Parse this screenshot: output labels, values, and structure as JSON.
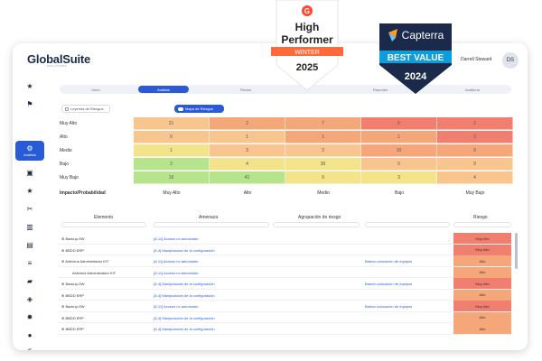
{
  "brand": {
    "name": "GlobalSuite",
    "sub": "SOLUTIONS",
    "user": "Darrell Steward",
    "avatar": "DS"
  },
  "sidebar": {
    "active_label": "Análisis"
  },
  "tabs": [
    "Inicio",
    "Análisis",
    "Planes",
    "",
    "Reportes",
    "Auditoría"
  ],
  "controls": {
    "legend_label": "Leyenda de Riesgos",
    "heatmap_label": "Mapa de Riesgos"
  },
  "heatmap": {
    "axis_label": "Impacto/Probabilidad",
    "rows": [
      "Muy Alto",
      "Alto",
      "Medio",
      "Bajo",
      "Muy Bajo"
    ],
    "cols": [
      "Muy Alto",
      "Alto",
      "Medio",
      "Bajo",
      "Muy Bajo"
    ],
    "values": [
      [
        "21",
        "2",
        "7",
        "0",
        "2"
      ],
      [
        "0",
        "1",
        "1",
        "1",
        "3"
      ],
      [
        "1",
        "3",
        "3",
        "10",
        "9"
      ],
      [
        "2",
        "4",
        "30",
        "0",
        "9"
      ],
      [
        "16",
        "41",
        "9",
        "3",
        "4"
      ]
    ]
  },
  "table": {
    "headers": [
      "Elemento",
      "Amenaza",
      "Agrupación de riesgo",
      "",
      "Riesgo"
    ],
    "rows": [
      {
        "el": "Backup-SW",
        "am": "[A.11] Acceso no autorizado",
        "ag": "",
        "op": "",
        "r": "Muy Alto"
      },
      {
        "el": "BBDD ERP",
        "am": "[A.4] Manipulación de la configuración",
        "ag": "",
        "op": "",
        "r": "Muy Alto"
      },
      {
        "el": "Antivirus Administrador KIT",
        "am": "[A.11] Acceso no autorizado",
        "ag": "",
        "op": "Baena colocación de equipos",
        "r": "Alto"
      },
      {
        "el": "Antivirus Administrador KIT",
        "am": "[A.11] Acceso no autorizado",
        "ag": "",
        "op": "",
        "r": "Alto"
      },
      {
        "el": "Backup-SW",
        "am": "[A.4] Manipulación de la configuración",
        "ag": "",
        "op": "Baena colocación de equipos",
        "r": "Muy Alto"
      },
      {
        "el": "BBDD ERP",
        "am": "[A.4] Manipulación de la configuración",
        "ag": "",
        "op": "",
        "r": "Alto"
      },
      {
        "el": "Backup-SW",
        "am": "[A.11] Acceso no autorizado",
        "ag": "",
        "op": "Baena colocación de equipos",
        "r": "Muy Alto"
      },
      {
        "el": "BBDD ERP",
        "am": "[A.4] Manipulación de la configuración",
        "ag": "",
        "op": "",
        "r": "Alto"
      },
      {
        "el": "BBDD ERP",
        "am": "[A.4] Manipulación de la configuración",
        "ag": "",
        "op": "",
        "r": "Alto"
      }
    ]
  },
  "badges": {
    "g2": {
      "brand": "G",
      "l1": "High",
      "l2": "Performer",
      "season": "WINTER",
      "year": "2025"
    },
    "capterra": {
      "brand": "Capterra",
      "l1": "BEST VALUE",
      "year": "2024"
    }
  },
  "colors": {
    "accent": "#2a5bd7",
    "red": "#f07f6f",
    "orange": "#f5a77a",
    "yellow": "#f3e38a",
    "green": "#b5e48c",
    "peach": "#f8c58e"
  }
}
